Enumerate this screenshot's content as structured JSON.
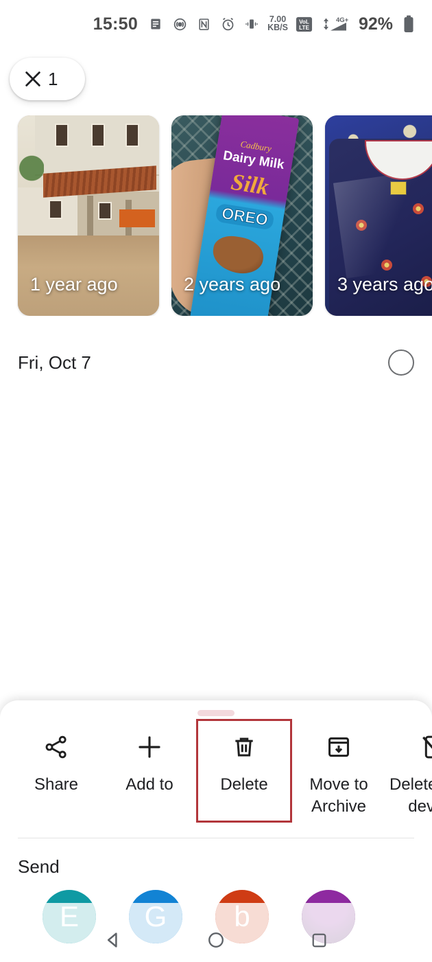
{
  "status_bar": {
    "time": "15:50",
    "data_rate_value": "7.00",
    "data_rate_unit": "KB/S",
    "volte_line1": "VoL",
    "volte_line2": "LTE",
    "network": "4G+",
    "battery_percent": "92%",
    "icons": [
      "notification-icon",
      "hotspot-icon",
      "nfc-icon",
      "alarm-icon",
      "vibrate-icon",
      "data-rate-icon",
      "volte-icon",
      "signal-icon",
      "battery-icon"
    ]
  },
  "selection_bar": {
    "close_icon": "close-icon",
    "count": "1"
  },
  "memories": [
    {
      "label": "1 year ago",
      "subject": "old-building-photo"
    },
    {
      "label": "2 years ago",
      "subject": "cadbury-dairy-milk-silk-oreo-photo",
      "brand": "Cadbury",
      "product_line1": "Dairy Milk",
      "product_line2": "Silk",
      "product_line3": "OREO"
    },
    {
      "label": "3 years ago",
      "subject": "packaged-garment-photo"
    }
  ],
  "date_section": {
    "date": "Fri, Oct 7",
    "select_circle": "select-all-circle"
  },
  "bottom_sheet": {
    "grabber": "drag-handle",
    "actions": [
      {
        "label": "Share",
        "icon": "share-icon",
        "highlighted": false
      },
      {
        "label": "Add to",
        "icon": "plus-icon",
        "highlighted": false
      },
      {
        "label": "Delete",
        "icon": "trash-icon",
        "highlighted": true
      },
      {
        "label": "Move to\nArchive",
        "icon": "archive-icon",
        "highlighted": false
      },
      {
        "label": "Delete from\ndevice",
        "icon": "delete-from-device-icon",
        "highlighted": false
      }
    ],
    "highlight_color": "#b2363b",
    "send_title": "Send",
    "contacts": [
      {
        "letter": "E",
        "color": "#0f9aa3"
      },
      {
        "letter": "G",
        "color": "#1283d4"
      },
      {
        "letter": "b",
        "color": "#cf3c14"
      },
      {
        "letter": "",
        "color": "#8e2aa0",
        "type": "photo"
      }
    ]
  },
  "nav_bar": {
    "back": "back-triangle-icon",
    "home": "home-circle-icon",
    "recents": "recents-square-icon"
  }
}
